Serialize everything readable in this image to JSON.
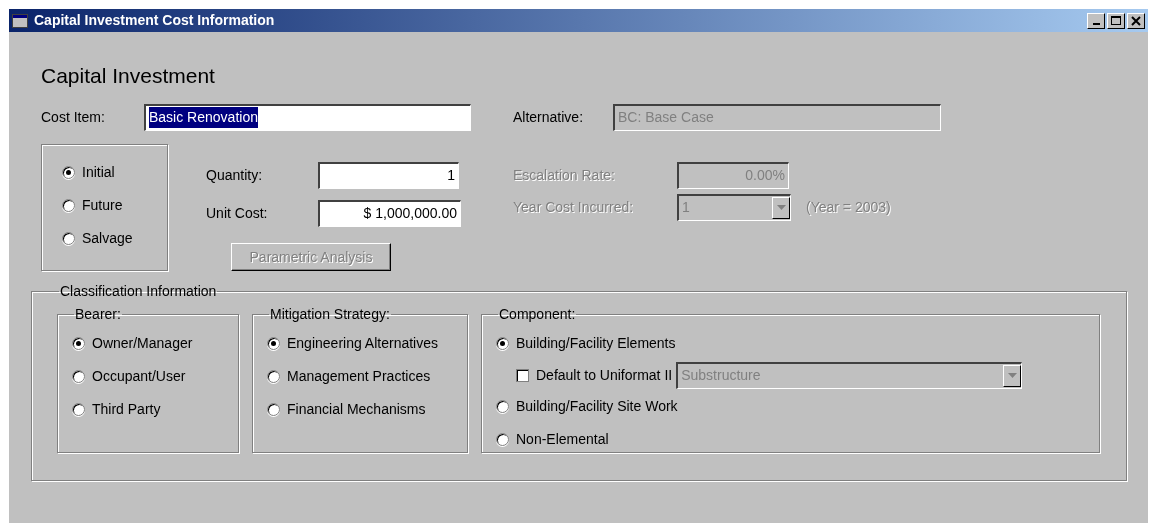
{
  "window": {
    "title": "Capital Investment Cost Information"
  },
  "heading": "Capital Investment",
  "cost_item": {
    "label": "Cost Item:",
    "value": "Basic Renovation"
  },
  "alternative": {
    "label": "Alternative:",
    "value": "BC: Base Case",
    "disabled": true
  },
  "timing": [
    {
      "label": "Initial",
      "selected": true
    },
    {
      "label": "Future",
      "selected": false
    },
    {
      "label": "Salvage",
      "selected": false
    }
  ],
  "quantity": {
    "label": "Quantity:",
    "value": "1"
  },
  "unit_cost": {
    "label": "Unit Cost:",
    "value": "$ 1,000,000.00"
  },
  "parametric_button": {
    "label": "Parametric Analysis",
    "disabled": true
  },
  "escalation_rate": {
    "label": "Escalation Rate:",
    "value": "0.00%",
    "disabled": true
  },
  "year_cost_incurred": {
    "label": "Year Cost Incurred:",
    "value": "1",
    "note": "(Year = 2003)",
    "disabled": true
  },
  "classification": {
    "title": "Classification Information",
    "groups": [
      {
        "title": "Bearer:",
        "options": [
          {
            "label": "Owner/Manager",
            "selected": true
          },
          {
            "label": "Occupant/User",
            "selected": false
          },
          {
            "label": "Third Party",
            "selected": false
          }
        ]
      },
      {
        "title": "Mitigation Strategy:",
        "options": [
          {
            "label": "Engineering Alternatives",
            "selected": true
          },
          {
            "label": "Management Practices",
            "selected": false
          },
          {
            "label": "Financial Mechanisms",
            "selected": false
          }
        ]
      },
      {
        "title": "Component:",
        "options": [
          {
            "label": "Building/Facility Elements",
            "selected": true
          },
          {
            "label": "Building/Facility Site Work",
            "selected": false
          },
          {
            "label": "Non-Elemental",
            "selected": false
          }
        ],
        "uniformat": {
          "label": "Default to Uniformat II",
          "checked": false,
          "value": "Substructure",
          "disabled": true
        }
      }
    ]
  }
}
